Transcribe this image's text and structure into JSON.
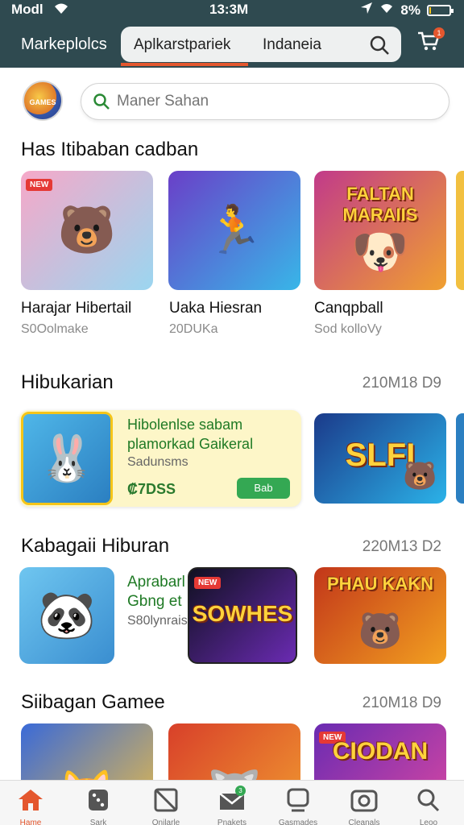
{
  "status_bar": {
    "carrier": "Modl",
    "time": "13:3M",
    "battery": "8%",
    "battery_level": 0.08
  },
  "header": {
    "brand": "Markeplolcs",
    "tab_primary": "Aplkarstpariek",
    "tab_secondary": "Indaneia",
    "cart_badge": "1"
  },
  "search": {
    "avatar_text": "GAMES",
    "placeholder": "Maner Sahan"
  },
  "sections": [
    {
      "title": "Has Itibaban cadban",
      "cards": [
        {
          "name": "Harajar Hibertail",
          "sub": "S0Oolmake",
          "tag": "NEW",
          "icon": "bear-character-icon",
          "colors": [
            "#f6a8c8",
            "#9bd6f0"
          ]
        },
        {
          "name": "Uaka Hiesran",
          "sub": "20DUKa",
          "icon": "runner-game-icon",
          "colors": [
            "#6a3fc8",
            "#38b6e8"
          ]
        },
        {
          "name": "Canqpball",
          "sub": "Sod kolloVy",
          "banner": "FALTAN MARAIIS",
          "icon": "friends-characters-icon",
          "colors": [
            "#c13a8a",
            "#f0a030"
          ]
        }
      ]
    },
    {
      "title": "Hibukarian",
      "meta": "210M18 D9",
      "featured": {
        "line1": "Hibolenlse sabam",
        "line2": "plamorkad Gaikeral",
        "line3": "Sadunsms",
        "price": "₡7DSS",
        "button": "Bab"
      },
      "card": {
        "banner": "SLFI",
        "icon": "bear-arcade-icon",
        "colors": [
          "#1b3a8a",
          "#2bb2e8"
        ]
      }
    },
    {
      "title": "Kabagaii Hiburan",
      "meta": "220M13 D2",
      "small_card": {
        "icon": "bear-sailor-icon",
        "colors": [
          "#6fc6f0",
          "#3a8ed0"
        ]
      },
      "text_lines": [
        "Aprabarl",
        "Gbng et",
        "S80lynrais"
      ],
      "cards": [
        {
          "banner": "SOWHES",
          "tag": "NEW",
          "icon": "neon-game-icon",
          "colors": [
            "#101020",
            "#6a2bb2"
          ]
        },
        {
          "banner": "PHAU KAKN",
          "icon": "bear-squad-icon",
          "colors": [
            "#c2361a",
            "#f2a020"
          ]
        }
      ]
    },
    {
      "title": "Siibagan Gamee",
      "meta": "210M18 D9",
      "cards": [
        {
          "icon": "cat-party-icon",
          "colors": [
            "#3a6ad8",
            "#f2c040"
          ]
        },
        {
          "icon": "wolf-character-icon",
          "colors": [
            "#d8402a",
            "#f2a030"
          ]
        },
        {
          "banner": "CIODAN",
          "tag": "NEW",
          "icon": "bear-title-icon",
          "colors": [
            "#6a2bb2",
            "#e24aa0"
          ]
        }
      ]
    }
  ],
  "bottom_nav": [
    {
      "label": "Hame",
      "icon": "home-icon",
      "active": true
    },
    {
      "label": "Sark",
      "icon": "dice-icon"
    },
    {
      "label": "Onilarle",
      "icon": "apps-icon"
    },
    {
      "label": "Pnakets",
      "icon": "mail-icon",
      "badge": "3"
    },
    {
      "label": "Gasmades",
      "icon": "chat-icon"
    },
    {
      "label": "Cleanals",
      "icon": "camera-icon"
    },
    {
      "label": "Leoo",
      "icon": "search-icon"
    }
  ],
  "colors": {
    "header_bg": "#2f4a50",
    "accent": "#e4572e",
    "green": "#34a853"
  }
}
